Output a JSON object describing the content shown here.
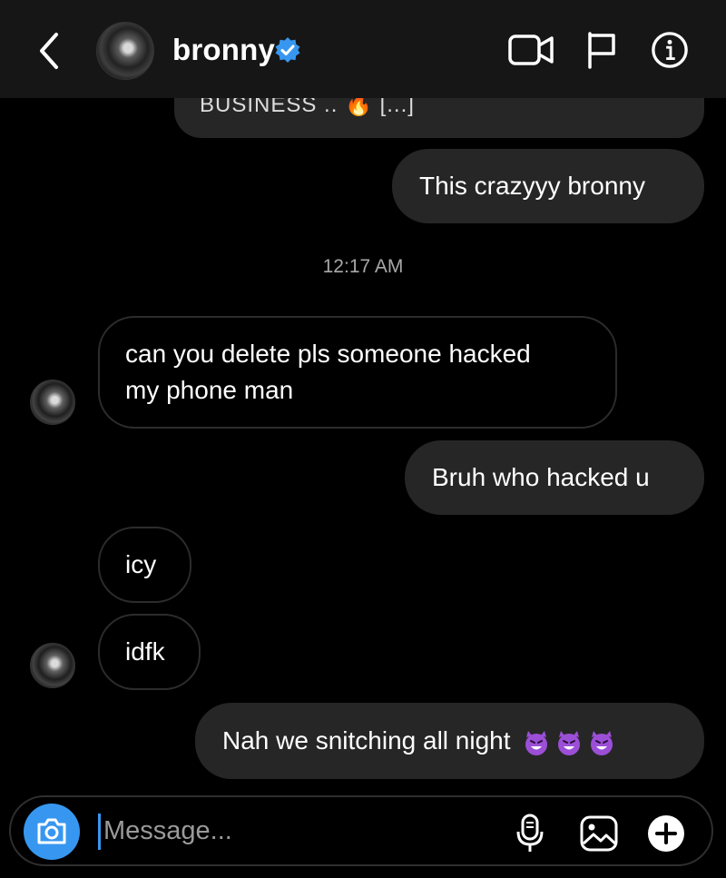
{
  "header": {
    "username": "bronny",
    "icons": [
      "back-icon",
      "verified-icon",
      "video-call-icon",
      "flag-icon",
      "info-icon"
    ]
  },
  "thread": {
    "partial_message": "BUSINESS .. 🔥 [...]",
    "timestamp": "12:17 AM",
    "messages": [
      {
        "from": "me",
        "text": "This crazyyy bronny"
      },
      {
        "from": "them",
        "line1": "can you delete pls someone hacked",
        "line2": "my phone man"
      },
      {
        "from": "me",
        "text": "Bruh who hacked u"
      },
      {
        "from": "them",
        "text": "icy"
      },
      {
        "from": "them",
        "text": "idfk"
      },
      {
        "from": "me",
        "text": "Nah we snitching all night",
        "emojis": [
          "smiling-devil-emoji",
          "smiling-devil-emoji",
          "smiling-devil-emoji"
        ]
      }
    ]
  },
  "composer": {
    "placeholder": "Message...",
    "icons": [
      "camera-icon",
      "mic-icon",
      "gallery-icon",
      "plus-icon"
    ]
  },
  "colors": {
    "background": "#000000",
    "header": "#161616",
    "sent_bubble": "#262626",
    "received_border": "#2c2c2c",
    "accent": "#3797f0",
    "devil_emoji": "#9b4fd6"
  }
}
